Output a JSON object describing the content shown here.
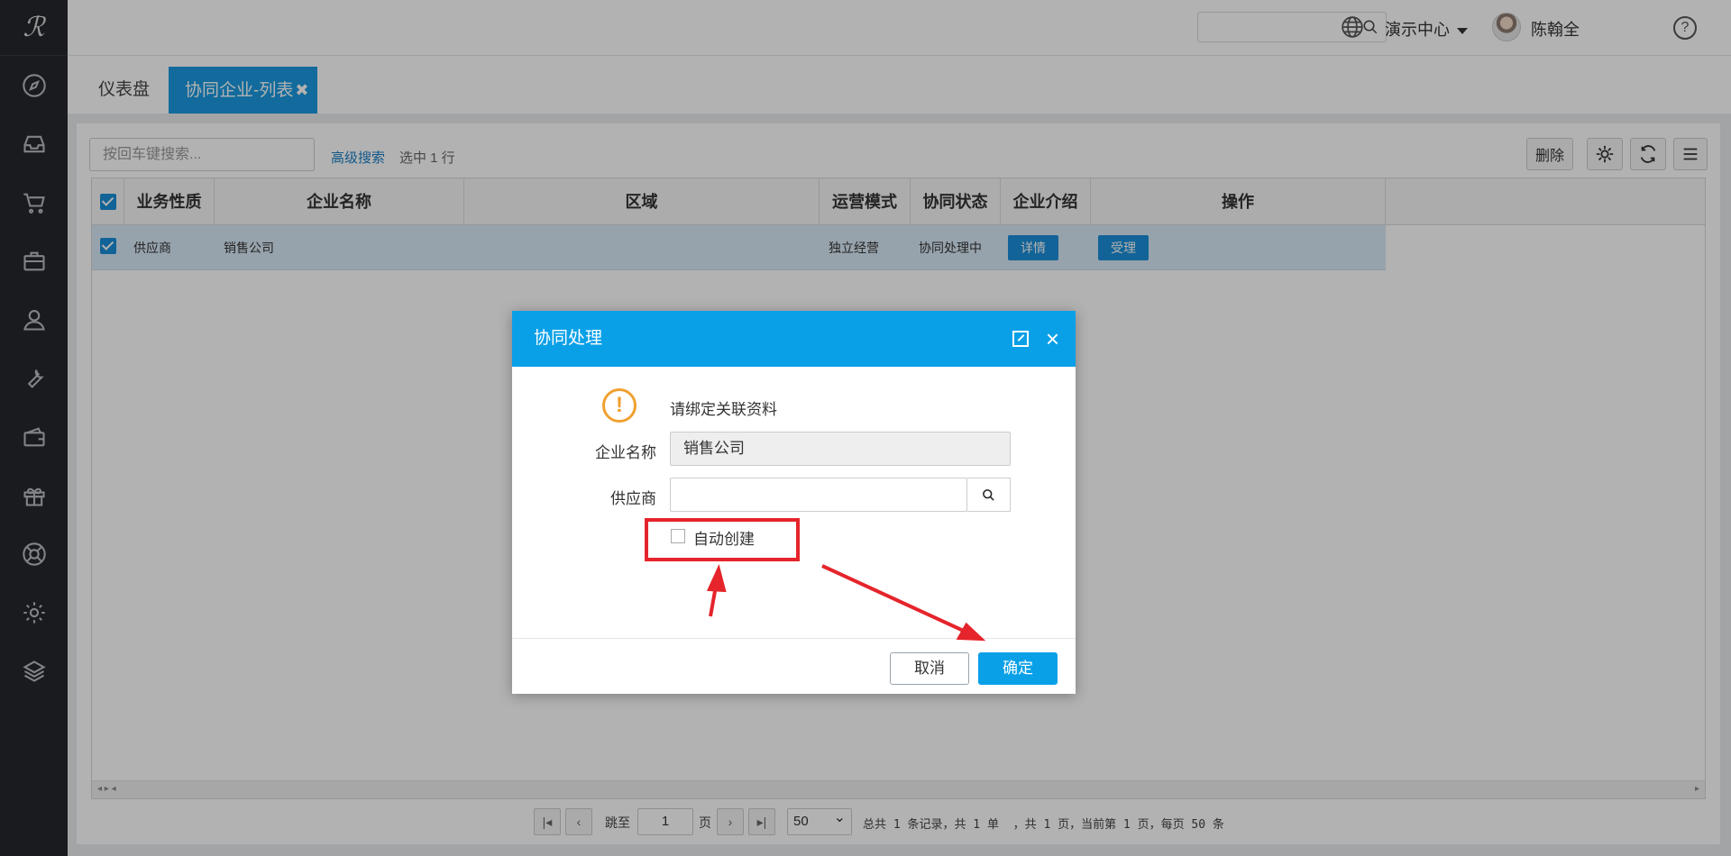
{
  "topbar": {
    "center_label": "演示中心",
    "user_name": "陈翰全",
    "help_glyph": "?"
  },
  "tabs": [
    {
      "label": "仪表盘"
    },
    {
      "label": "协同企业-列表",
      "close": "✖"
    }
  ],
  "toolbar": {
    "search_placeholder": "按回车键搜索...",
    "advanced_search": "高级搜索",
    "selection_status": "选中 1 行",
    "delete_label": "删除"
  },
  "grid": {
    "columns": [
      "业务性质",
      "企业名称",
      "区域",
      "运营模式",
      "协同状态",
      "企业介绍",
      "操作"
    ],
    "rows": [
      {
        "nature": "供应商",
        "company": "销售公司",
        "region": "",
        "mode": "独立经营",
        "status": "协同处理中",
        "intro_button": "详情",
        "action_button": "受理"
      }
    ]
  },
  "pager": {
    "jump_label": "跳至",
    "page_value": "1",
    "page_unit": "页",
    "page_size": "50",
    "summary": "总共 1 条记录，共 1 单  ，共 1 页，当前第 1 页，每页 50 条"
  },
  "modal": {
    "title": "协同处理",
    "warning": "请绑定关联资料",
    "company_label": "企业名称",
    "company_value": "销售公司",
    "supplier_label": "供应商",
    "supplier_value": "",
    "auto_create_label": "自动创建",
    "auto_create_checked": false,
    "cancel_label": "取消",
    "ok_label": "确定"
  },
  "colors": {
    "accent": "#0aa0e8",
    "annotation": "#e5242b",
    "warning": "#f0a030"
  }
}
